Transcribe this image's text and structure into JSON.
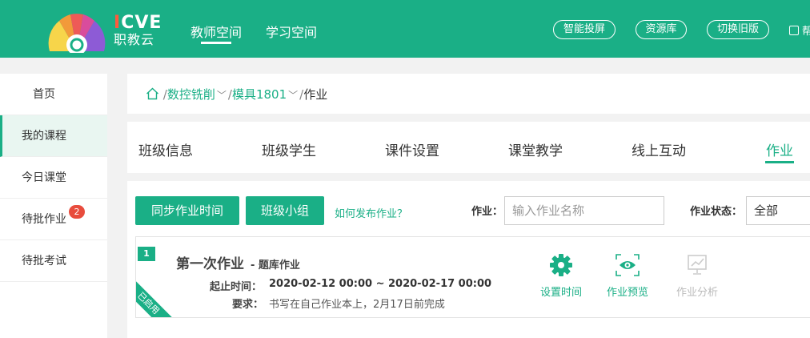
{
  "header": {
    "logo_en": "ICVE",
    "logo_cn": "职教云",
    "nav": [
      "教师空间",
      "学习空间"
    ],
    "buttons": [
      "智能投屏",
      "资源库",
      "切换旧版"
    ],
    "help": "帮"
  },
  "sidebar": {
    "items": [
      {
        "label": "首页"
      },
      {
        "label": "我的课程"
      },
      {
        "label": "今日课堂"
      },
      {
        "label": "待批作业",
        "badge": "2"
      },
      {
        "label": "待批考试"
      }
    ]
  },
  "breadcrumb": {
    "sep": "/",
    "items": [
      "数控铣削",
      "模具1801",
      "作业"
    ]
  },
  "tabs": [
    "班级信息",
    "班级学生",
    "课件设置",
    "课堂教学",
    "线上互动",
    "作业"
  ],
  "toolbar": {
    "sync_label": "同步作业时间",
    "group_label": "班级小组",
    "how_link": "如何发布作业？",
    "hw_label": "作业：",
    "hw_placeholder": "输入作业名称",
    "status_label": "作业状态：",
    "status_value": "全部"
  },
  "assignment": {
    "index": "1",
    "title": "第一次作业",
    "subtype": "- 题库作业",
    "time_label": "起止时间：",
    "time_value": "2020-02-12 00:00 ~ 2020-02-17 00:00",
    "req_label": "要求：",
    "req_value": "书写在自己作业本上，2月17日前完成",
    "ribbon": "已启用",
    "actions": [
      "设置时间",
      "作业预览",
      "作业分析"
    ]
  },
  "colors": {
    "brand": "#1aaf86",
    "badge": "#e84c3d",
    "logo_accent": "#ff5a3c"
  }
}
